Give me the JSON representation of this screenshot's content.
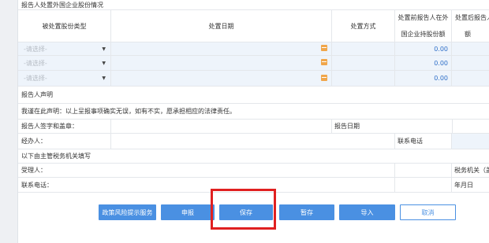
{
  "section_title": "报告人处置外国企业股份情况",
  "table": {
    "headers": {
      "type": "被处置股份类型",
      "date": "处置日期",
      "method": "处置方式",
      "before_line1": "处置前报告人在外",
      "before_line2": "国企业持股份额",
      "after_line1": "处置后报告人在外",
      "after_line2": "额"
    },
    "rows": [
      {
        "type_placeholder": "-请选择-",
        "amount": "0.00"
      },
      {
        "type_placeholder": "-请选择-",
        "amount": "0.00"
      },
      {
        "type_placeholder": "-请选择-",
        "amount": "0.00"
      }
    ]
  },
  "declaration": {
    "title": "报告人声明",
    "text": "我谨在此声明：以上呈报事项确实无误，如有不实，愿承担相应的法律责任。",
    "signature_label": "报告人签字和盖章：",
    "report_date_label": "报告日期",
    "handler_label": "经办人：",
    "phone_label": "联系电话"
  },
  "tax_office": {
    "title": "以下由主管税务机关填写",
    "receiver_label": "受理人：",
    "office_label": "税务机关（盖章）",
    "phone_label": "联系电话：",
    "date_label": "年月日"
  },
  "buttons": {
    "policy": "政策风险提示服务",
    "declare": "申报",
    "save": "保存",
    "draft": "暂存",
    "import": "导入",
    "cancel": "取消"
  }
}
